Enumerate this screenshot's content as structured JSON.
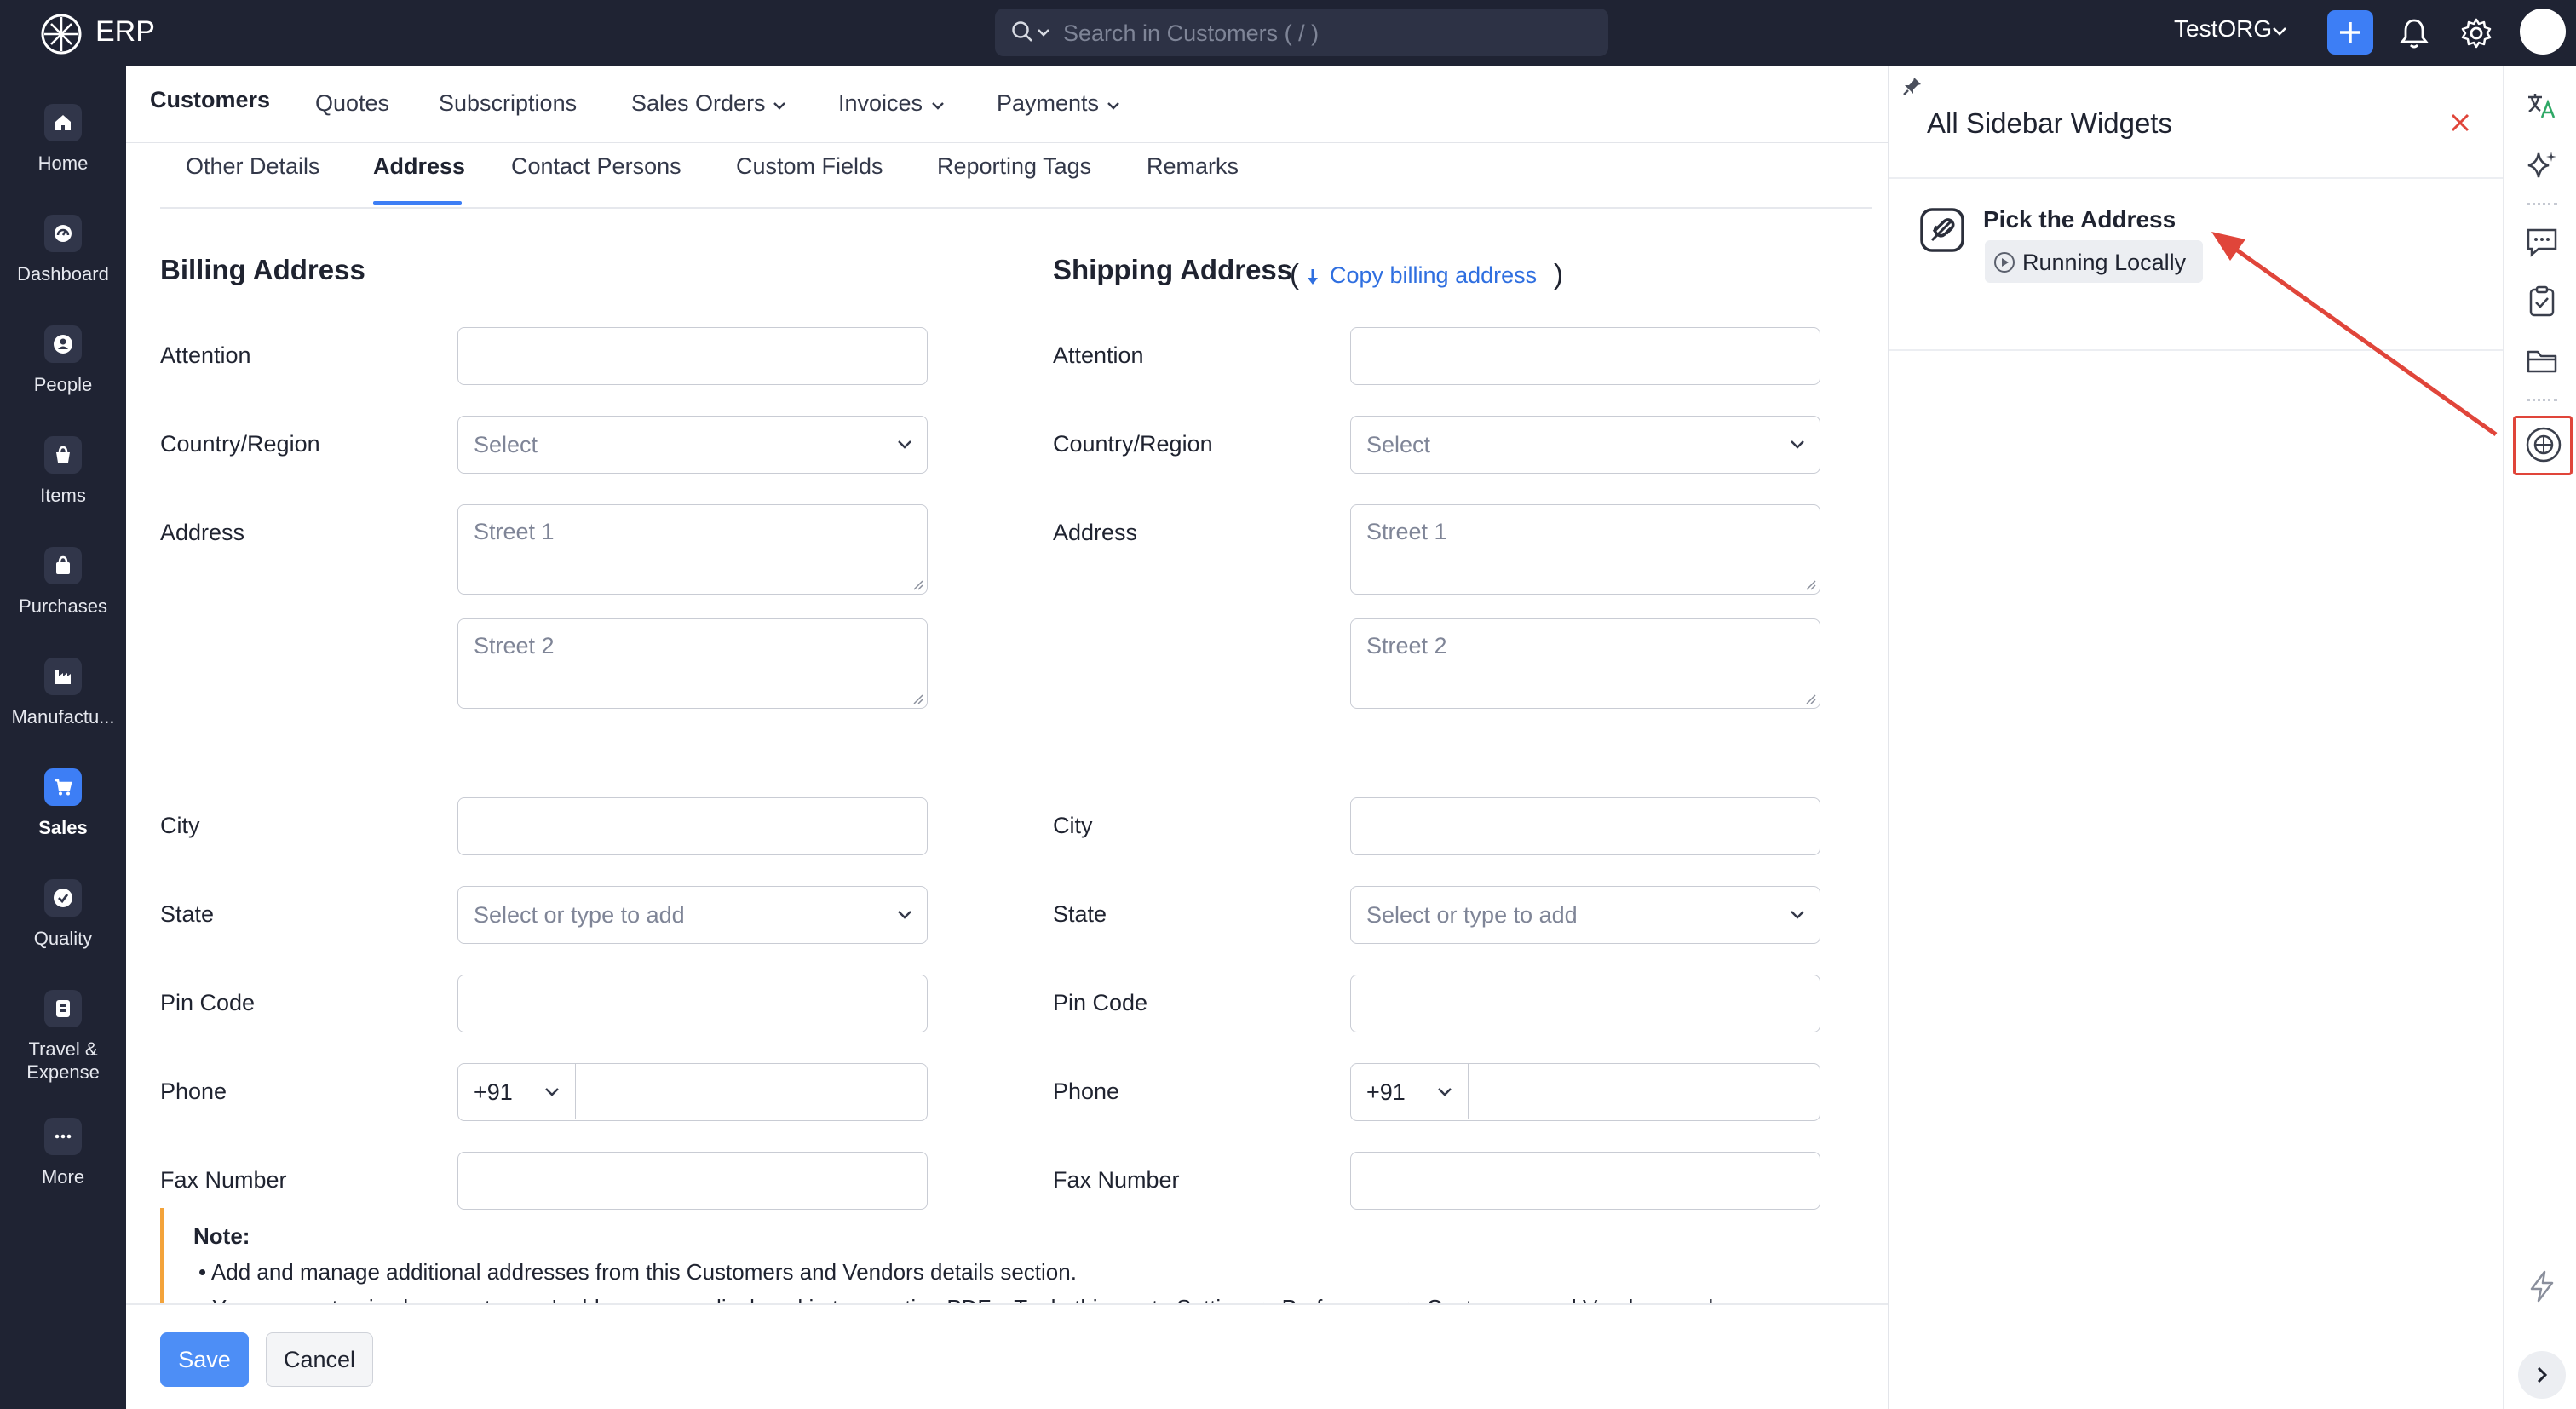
{
  "app": {
    "name": "ERP"
  },
  "search": {
    "placeholder": "Search in Customers ( / )"
  },
  "org": {
    "name": "TestORG"
  },
  "left_nav": [
    {
      "key": "home",
      "label": "Home",
      "icon": "home-icon"
    },
    {
      "key": "dashboard",
      "label": "Dashboard",
      "icon": "dashboard-icon"
    },
    {
      "key": "people",
      "label": "People",
      "icon": "people-icon"
    },
    {
      "key": "items",
      "label": "Items",
      "icon": "items-icon"
    },
    {
      "key": "purchases",
      "label": "Purchases",
      "icon": "purchases-icon"
    },
    {
      "key": "manufacturing",
      "label": "Manufactu...",
      "icon": "manufacturing-icon"
    },
    {
      "key": "sales",
      "label": "Sales",
      "icon": "sales-icon",
      "active": true
    },
    {
      "key": "quality",
      "label": "Quality",
      "icon": "quality-icon"
    },
    {
      "key": "travel",
      "label": "Travel &\nExpense",
      "icon": "travel-expense-icon"
    },
    {
      "key": "more",
      "label": "More",
      "icon": "more-icon"
    }
  ],
  "module_tabs": [
    {
      "label": "Customers",
      "active": true
    },
    {
      "label": "Quotes"
    },
    {
      "label": "Subscriptions"
    },
    {
      "label": "Sales Orders",
      "dropdown": true
    },
    {
      "label": "Invoices",
      "dropdown": true
    },
    {
      "label": "Payments",
      "dropdown": true
    }
  ],
  "sub_tabs": [
    {
      "label": "Other Details"
    },
    {
      "label": "Address",
      "active": true
    },
    {
      "label": "Contact Persons"
    },
    {
      "label": "Custom Fields"
    },
    {
      "label": "Reporting Tags"
    },
    {
      "label": "Remarks"
    }
  ],
  "billing": {
    "title": "Billing Address",
    "labels": {
      "attention": "Attention",
      "country": "Country/Region",
      "address": "Address",
      "city": "City",
      "state": "State",
      "pin": "Pin Code",
      "phone": "Phone",
      "fax": "Fax Number"
    },
    "country_placeholder": "Select",
    "street1_placeholder": "Street 1",
    "street2_placeholder": "Street 2",
    "state_placeholder": "Select or type to add",
    "phone_code": "+91"
  },
  "shipping": {
    "title": "Shipping Address",
    "open_paren": "(",
    "close_paren": ")",
    "copy_link": "Copy billing address",
    "labels": {
      "attention": "Attention",
      "country": "Country/Region",
      "address": "Address",
      "city": "City",
      "state": "State",
      "pin": "Pin Code",
      "phone": "Phone",
      "fax": "Fax Number"
    },
    "country_placeholder": "Select",
    "street1_placeholder": "Street 1",
    "street2_placeholder": "Street 2",
    "state_placeholder": "Select or type to add",
    "phone_code": "+91"
  },
  "note": {
    "title": "Note:",
    "lines": [
      "• Add and manage additional addresses from this Customers and Vendors details section.",
      "• You can customise how customers' addresses are displayed in transaction PDFs. To do this, go to Settings > Preferences > Customers and Vendors, and"
    ]
  },
  "footer": {
    "save": "Save",
    "cancel": "Cancel"
  },
  "widget_panel": {
    "title": "All Sidebar Widgets",
    "widget": {
      "title": "Pick the Address",
      "status": "Running Locally",
      "icon": "widget-link-icon"
    }
  },
  "right_strip_icons": [
    "translate-icon",
    "sparkle-icon",
    "chat-icon",
    "task-icon",
    "folder-icon",
    "widget-icon",
    "lightning-icon",
    "expand-icon"
  ],
  "colors": {
    "accent": "#3d7ef5",
    "nav_bg": "#1f2333",
    "annotation_red": "#e0453a",
    "note_border": "#f3a33a",
    "link": "#2f6fe0"
  }
}
